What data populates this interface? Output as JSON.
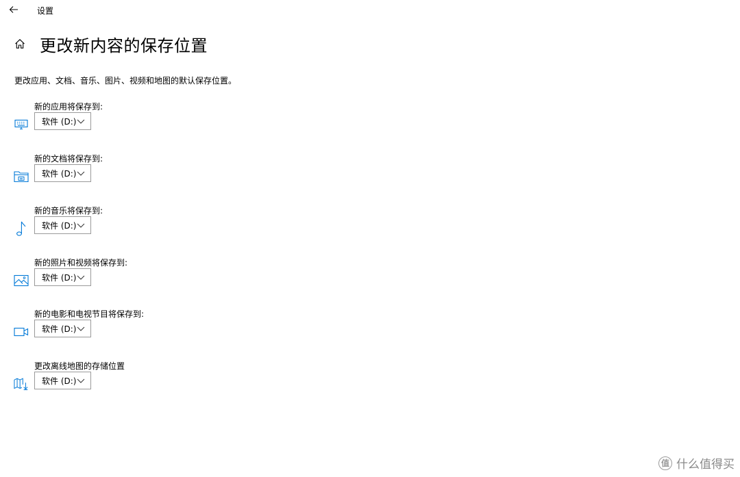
{
  "window": {
    "title": "设置"
  },
  "page": {
    "title": "更改新内容的保存位置",
    "description": "更改应用、文档、音乐、图片、视频和地图的默认保存位置。"
  },
  "settings": [
    {
      "label": "新的应用将保存到:",
      "value": "软件 (D:)",
      "icon": "monitor-icon"
    },
    {
      "label": "新的文档将保存到:",
      "value": "软件 (D:)",
      "icon": "document-folder-icon"
    },
    {
      "label": "新的音乐将保存到:",
      "value": "软件 (D:)",
      "icon": "music-note-icon"
    },
    {
      "label": "新的照片和视频将保存到:",
      "value": "软件 (D:)",
      "icon": "picture-icon"
    },
    {
      "label": "新的电影和电视节目将保存到:",
      "value": "软件 (D:)",
      "icon": "video-camera-icon"
    },
    {
      "label": "更改离线地图的存储位置",
      "value": "软件 (D:)",
      "icon": "map-download-icon"
    }
  ],
  "watermark": {
    "text": "什么值得买",
    "logo_glyph": "值"
  },
  "colors": {
    "accent": "#0078d7",
    "border": "#999999",
    "text": "#000000"
  }
}
